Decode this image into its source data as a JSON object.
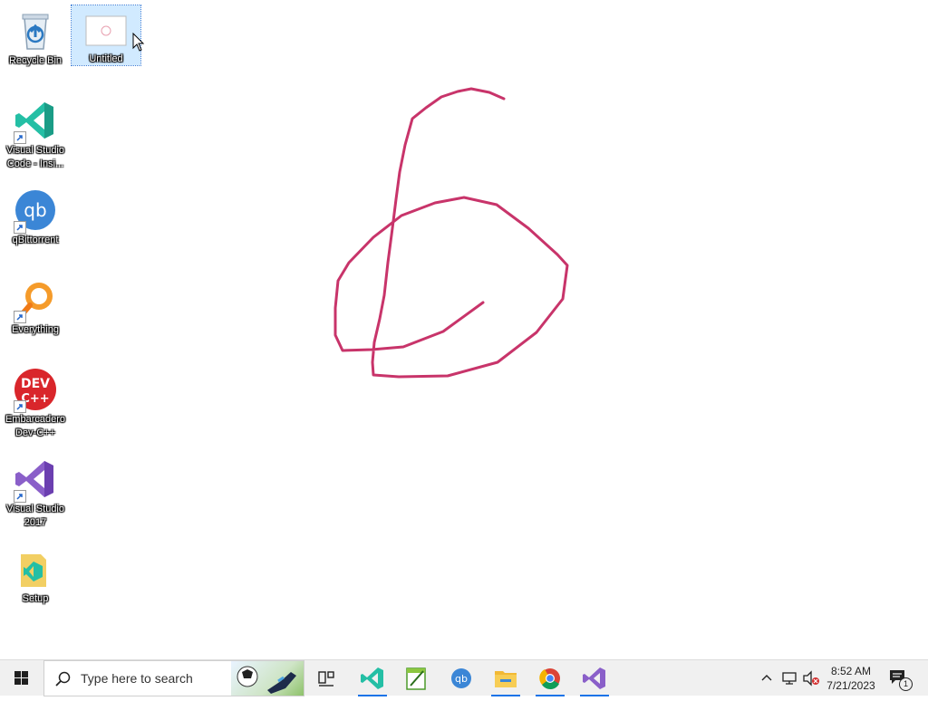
{
  "desktop": {
    "icons": [
      {
        "name": "recycle-bin",
        "label": "Recycle Bin"
      },
      {
        "name": "untitled-file",
        "label": "Untitled"
      },
      {
        "name": "vscode-insiders",
        "label": "Visual Studio Code - Insi..."
      },
      {
        "name": "qbittorrent",
        "label": "qBittorrent"
      },
      {
        "name": "everything",
        "label": "Everything"
      },
      {
        "name": "devcpp",
        "label": "Embarcadero Dev-C++"
      },
      {
        "name": "visual-studio-2017",
        "label": "Visual Studio 2017"
      },
      {
        "name": "setup",
        "label": "Setup"
      }
    ],
    "drawing_color": "#c8346a"
  },
  "taskbar": {
    "search_placeholder": "Type here to search",
    "clock_time": "8:52 AM",
    "clock_date": "7/21/2023",
    "notification_count": "1"
  }
}
